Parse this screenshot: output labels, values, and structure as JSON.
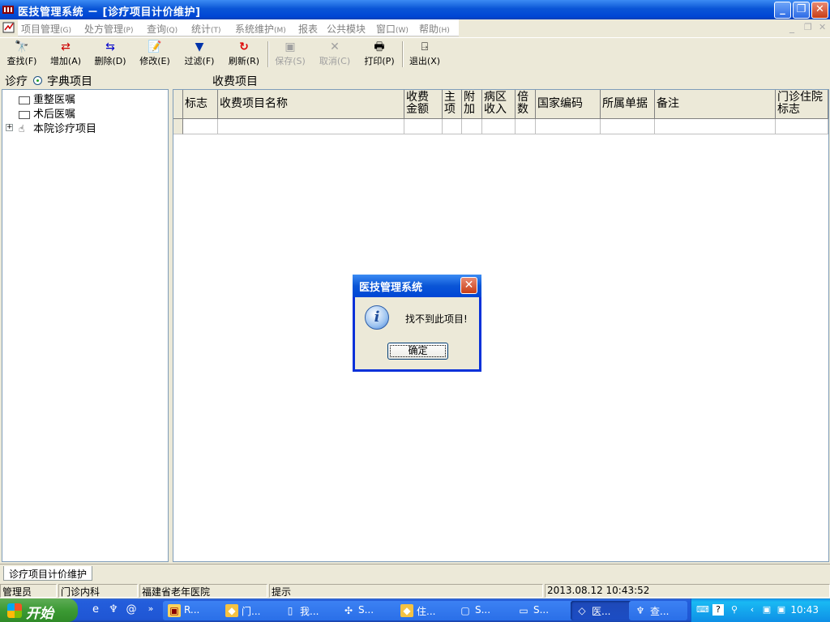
{
  "window": {
    "title": "医技管理系统 － [诊疗项目计价维护]"
  },
  "menubar": {
    "items": [
      {
        "label": "项目管理",
        "hotkey": "(G)"
      },
      {
        "label": "处方管理",
        "hotkey": "(P)"
      },
      {
        "label": "查询",
        "hotkey": "(Q)"
      },
      {
        "label": "统计",
        "hotkey": "(T)"
      },
      {
        "label": "系统维护",
        "hotkey": "(M)"
      },
      {
        "label": "报表",
        "hotkey": ""
      },
      {
        "label": "公共模块",
        "hotkey": ""
      },
      {
        "label": "窗口",
        "hotkey": "(W)"
      },
      {
        "label": "帮助",
        "hotkey": "(H)"
      }
    ]
  },
  "toolbar": {
    "find": "查找(F)",
    "add": "增加(A)",
    "delete": "删除(D)",
    "edit": "修改(E)",
    "filter": "过滤(F)",
    "refresh": "刷新(R)",
    "save": "保存(S)",
    "cancel": "取消(C)",
    "print": "打印(P)",
    "exit": "退出(X)"
  },
  "left_panel": {
    "prefix": "诊疗",
    "radio_label": "字典项目",
    "tree": [
      {
        "label": "重整医嘱"
      },
      {
        "label": "术后医嘱"
      },
      {
        "label": "本院诊疗项目"
      }
    ]
  },
  "grid": {
    "title": "收费项目",
    "columns": [
      "标志",
      "收费项目名称",
      "收费\n金额",
      "主\n项",
      "附\n加",
      "病区\n收入",
      "倍\n数",
      "国家编码",
      "所属单据",
      "备注",
      "门诊住院\n标志"
    ]
  },
  "dialog": {
    "title": "医技管理系统",
    "message": "找不到此项目!",
    "ok": "确定"
  },
  "mdi_tab": {
    "label": "诊疗项目计价维护"
  },
  "statusbar": {
    "user": "管理员",
    "department": "门诊内科",
    "hospital": "福建省老年医院",
    "hint": "提示",
    "datetime": "2013.08.12  10:43:52"
  },
  "taskbar": {
    "start": "开始",
    "tasks": [
      "R...",
      "门...",
      "我...",
      "S...",
      "住...",
      "S...",
      "S...",
      "医...",
      "查..."
    ],
    "active_index": 7,
    "clock": "10:43"
  }
}
